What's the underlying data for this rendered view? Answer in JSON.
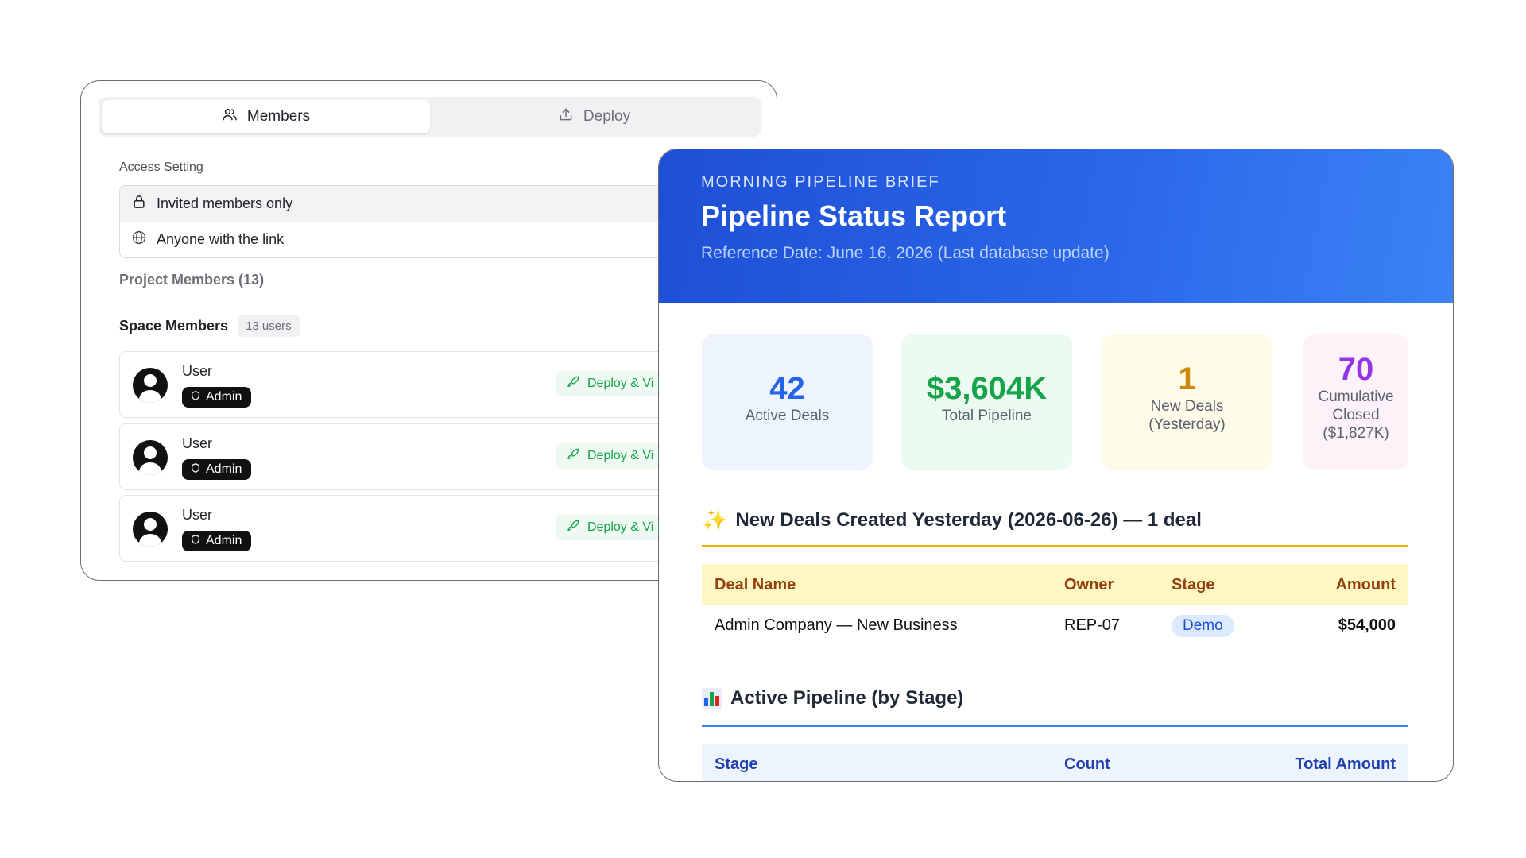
{
  "members_panel": {
    "tabs": [
      {
        "label": "Members",
        "icon": "users-icon",
        "active": true
      },
      {
        "label": "Deploy",
        "icon": "upload-icon",
        "active": false
      }
    ],
    "access_setting_label": "Access Setting",
    "access_options": [
      {
        "label": "Invited members only",
        "icon": "lock-icon",
        "selected": true
      },
      {
        "label": "Anyone with the link",
        "icon": "globe-icon",
        "selected": false
      }
    ],
    "project_members_label": "Project Members (13)",
    "space_members_title": "Space Members",
    "space_members_count": "13 users",
    "members": [
      {
        "name": "User",
        "role": "Admin",
        "action": "Deploy & Vi"
      },
      {
        "name": "User",
        "role": "Admin",
        "action": "Deploy & Vi"
      },
      {
        "name": "User",
        "role": "Admin",
        "action": "Deploy & Vi"
      }
    ]
  },
  "report": {
    "kicker": "MORNING PIPELINE BRIEF",
    "title": "Pipeline Status Report",
    "reference_date": "Reference Date: June 16, 2026 (Last database update)",
    "kpis": [
      {
        "value": "42",
        "label": "Active Deals",
        "color": "#2563eb"
      },
      {
        "value": "$3,604K",
        "label": "Total Pipeline",
        "color": "#16a34a"
      },
      {
        "value": "1",
        "label": "New Deals (Yesterday)",
        "color": "#ca8a04"
      },
      {
        "value": "70",
        "label": "Cumulative Closed ($1,827K)",
        "color": "#9333ea"
      }
    ],
    "new_deals_heading": "New Deals Created Yesterday (2026-06-26) — 1 deal",
    "new_deals_table": {
      "headers": [
        "Deal Name",
        "Owner",
        "Stage",
        "Amount"
      ],
      "rows": [
        {
          "deal_name": "Admin Company — New Business",
          "owner": "REP-07",
          "stage": "Demo",
          "amount": "$54,000"
        }
      ]
    },
    "pipeline_heading": "Active Pipeline (by Stage)",
    "pipeline_table": {
      "headers": [
        "Stage",
        "Count",
        "Total Amount"
      ]
    },
    "colors": {
      "header_gradient_start": "#1e4fd6",
      "header_gradient_end": "#3b82f6",
      "new_deals_rule": "#eab308",
      "pipeline_rule": "#3b82f6"
    }
  }
}
